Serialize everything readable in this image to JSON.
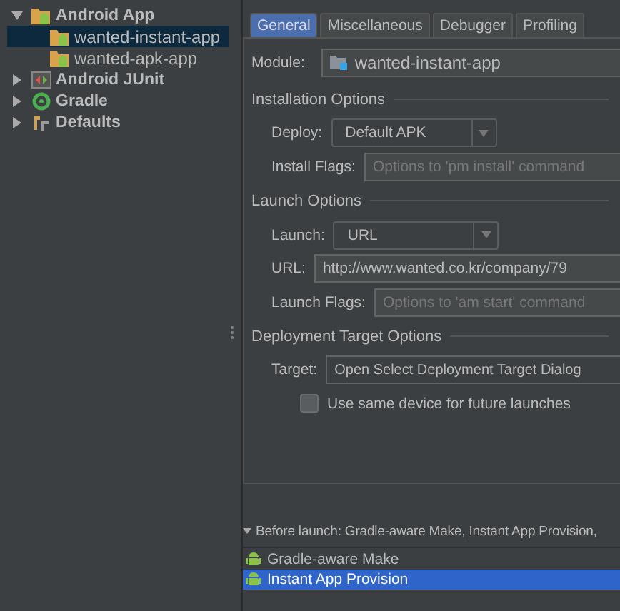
{
  "tree": [
    {
      "label": "Android App",
      "kind": "folder",
      "expanded": true,
      "selected": false,
      "children": [
        {
          "label": "wanted-instant-app",
          "kind": "folder",
          "selected": true
        },
        {
          "label": "wanted-apk-app",
          "kind": "folder",
          "selected": false
        }
      ]
    },
    {
      "label": "Android JUnit",
      "kind": "junit",
      "expanded": false,
      "selected": false
    },
    {
      "label": "Gradle",
      "kind": "gradle",
      "expanded": false,
      "selected": false
    },
    {
      "label": "Defaults",
      "kind": "defaults",
      "expanded": false,
      "selected": false
    }
  ],
  "tabs": [
    {
      "label": "General",
      "selected": true
    },
    {
      "label": "Miscellaneous",
      "selected": false
    },
    {
      "label": "Debugger",
      "selected": false
    },
    {
      "label": "Profiling",
      "selected": false
    }
  ],
  "module": {
    "label": "Module:",
    "value": "wanted-instant-app"
  },
  "installation": {
    "title": "Installation Options",
    "deploy": {
      "label": "Deploy:",
      "value": "Default APK"
    },
    "install_flags": {
      "label": "Install Flags:",
      "placeholder": "Options to 'pm install' command"
    }
  },
  "launch": {
    "title": "Launch Options",
    "launch": {
      "label": "Launch:",
      "value": "URL"
    },
    "url": {
      "label": "URL:",
      "value": "http://www.wanted.co.kr/company/79"
    },
    "launch_flags": {
      "label": "Launch Flags:",
      "placeholder": "Options to 'am start' command"
    }
  },
  "deployment": {
    "title": "Deployment Target Options",
    "target": {
      "label": "Target:",
      "value": "Open Select Deployment Target Dialog"
    },
    "same_device": {
      "label": "Use same device for future launches",
      "checked": false
    }
  },
  "before_launch": {
    "title": "Before launch: Gradle-aware Make, Instant App Provision,",
    "expanded": true,
    "tasks": [
      {
        "label": "Gradle-aware Make",
        "selected": false
      },
      {
        "label": "Instant App Provision",
        "selected": true
      }
    ]
  }
}
